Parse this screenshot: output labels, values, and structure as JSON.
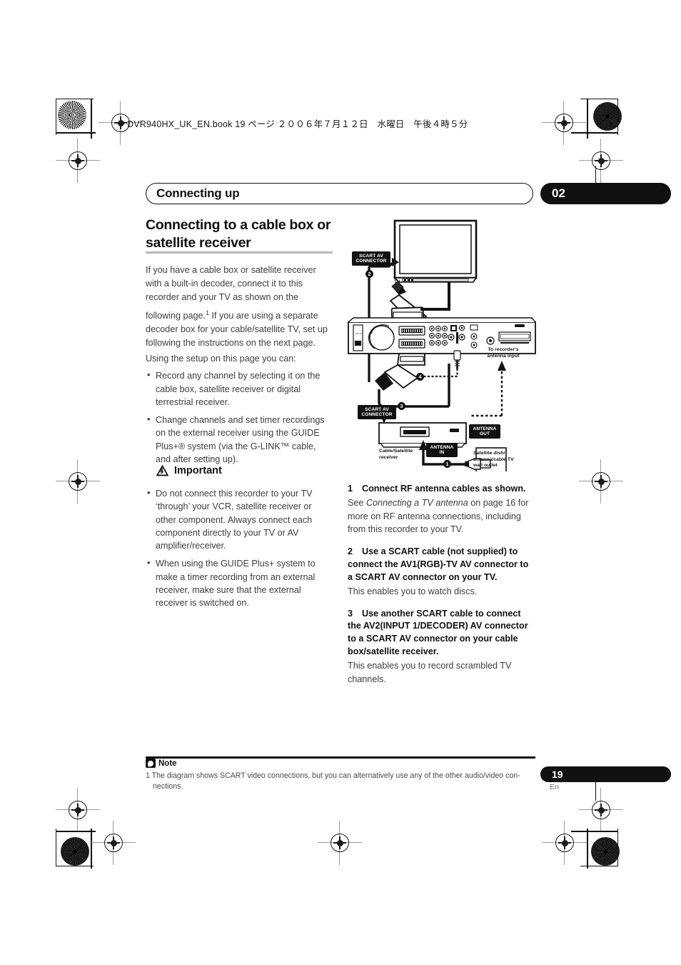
{
  "printer_marks": {
    "present": true
  },
  "book_header": {
    "text": "DVR940HX_UK_EN.book  19 ページ  ２００６年７月１２日　水曜日　午後４時５分"
  },
  "running_head": {
    "title": "Connecting up",
    "chapter_number": "02"
  },
  "main": {
    "heading": "Connecting to a cable box or satellite receiver",
    "intro_p1": "If you have a cable box or satellite receiver with a built-in decoder, connect it to this recorder and your TV as shown on the",
    "intro_p2_pre": "following page.",
    "intro_footnote_marker": "1",
    "intro_p2_post": " If you are using a separate decoder box for your cable/satellite TV, set up following the instructions on the next page.",
    "intro_p3": "Using the setup on this page you can:",
    "bullets": [
      "Record any channel by selecting it on the cable box, satellite receiver or digital terrestrial receiver.",
      "Change channels and set timer recordings on the external receiver using the GUIDE Plus+® system (via the G-LINK™ cable, and after setting up)."
    ],
    "important": {
      "title": "Important",
      "icon": "warning-triangle-icon",
      "bullets": [
        "Do not connect this recorder to your TV ‘through’ your VCR, satellite receiver or other component. Always connect each component directly to your TV or AV amplifier/receiver.",
        "When using the GUIDE Plus+ system to make a timer recording from an external receiver, make sure that the external receiver is switched on."
      ]
    },
    "steps": [
      {
        "number": "1",
        "title": "Connect RF antenna cables as shown.",
        "body_pre": "See ",
        "body_italic": "Connecting a TV antenna",
        "body_post": " on page 16 for more on RF antenna connections, including from this recorder to your TV."
      },
      {
        "number": "2",
        "title": "Use a SCART cable (not supplied) to connect the AV1(RGB)-TV AV connector to a SCART AV connector on your TV.",
        "body_pre": "This enables you to watch discs.",
        "body_italic": "",
        "body_post": ""
      },
      {
        "number": "3",
        "title": "Use another SCART cable to connect the AV2(INPUT 1/DECODER) AV connector to a SCART AV connector on your cable box/satellite receiver.",
        "body_pre": "This enables you to record scrambled TV channels.",
        "body_italic": "",
        "body_post": ""
      }
    ]
  },
  "diagram": {
    "labels": {
      "scart_av_connector_top_l1": "SCART AV",
      "scart_av_connector_top_l2": "CONNECTOR",
      "scart_av_connector_bottom_l1": "SCART AV",
      "scart_av_connector_bottom_l2": "CONNECTOR",
      "antenna_out_l1": "ANTENNA",
      "antenna_out_l2": "OUT",
      "antenna_in_l1": "ANTENNA",
      "antenna_in_l2": "IN"
    },
    "captions": {
      "tv": "TV",
      "to_recorders_antenna_input_l1": "To recorder's",
      "to_recorders_antenna_input_l2": "antenna input",
      "cable_satellite_receiver_l1": "Cable/Satellite",
      "cable_satellite_receiver_l2": "receiver",
      "wall_outlet_l1": "Satellite dish/",
      "wall_outlet_l2": "antenna/cable TV",
      "wall_outlet_l3": "wall outlet"
    },
    "callouts": [
      "1",
      "2",
      "3",
      "4"
    ]
  },
  "footer": {
    "note_title": "Note",
    "note_icon": "note-icon",
    "note_body_line1": "1 The diagram shows SCART video connections, but you can alternatively use any of the other audio/video con-",
    "note_body_line2": "nections.",
    "page_number": "19",
    "language": "En"
  },
  "colors": {
    "ink": "#111111",
    "body_text": "#3d3d3d",
    "rule_gray": "#b9b9b9"
  }
}
